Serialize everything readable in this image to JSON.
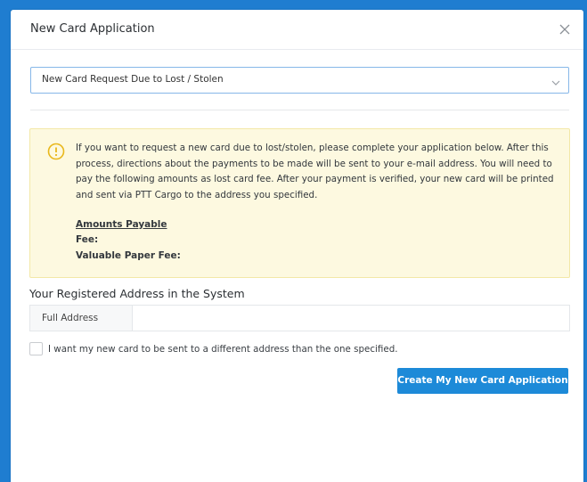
{
  "modal": {
    "title": "New Card Application",
    "close_icon": "close-icon"
  },
  "request_type": {
    "selected": "New Card Request Due to Lost / Stolen",
    "icon": "chevron-down-icon"
  },
  "notice": {
    "icon": "exclamation-circle-icon",
    "text": "If you want to request a new card due to lost/stolen, please complete your application below. After this process, directions about the payments to be made will be sent to your e-mail address. You will need to pay the following amounts as lost card fee. After your payment is verified, your new card will be printed and sent via PTT Cargo to the address you specified.",
    "amounts_title": "Amounts Payable",
    "fee_label": "Fee:",
    "paper_fee_label": "Valuable Paper Fee:"
  },
  "address": {
    "section_title": "Your Registered Address in the System",
    "prefix_label": "Full Address",
    "value": ""
  },
  "different_address": {
    "label": "I want my new card to be sent to a different address than the one specified.",
    "checked": false
  },
  "submit": {
    "label": "Create My New Card Application"
  },
  "colors": {
    "page_background": "#1f7dd0",
    "alert_background": "#fdf9e0",
    "alert_icon": "#e9b81c",
    "button": "#1d8ad8",
    "select_border": "#86b7e8"
  }
}
